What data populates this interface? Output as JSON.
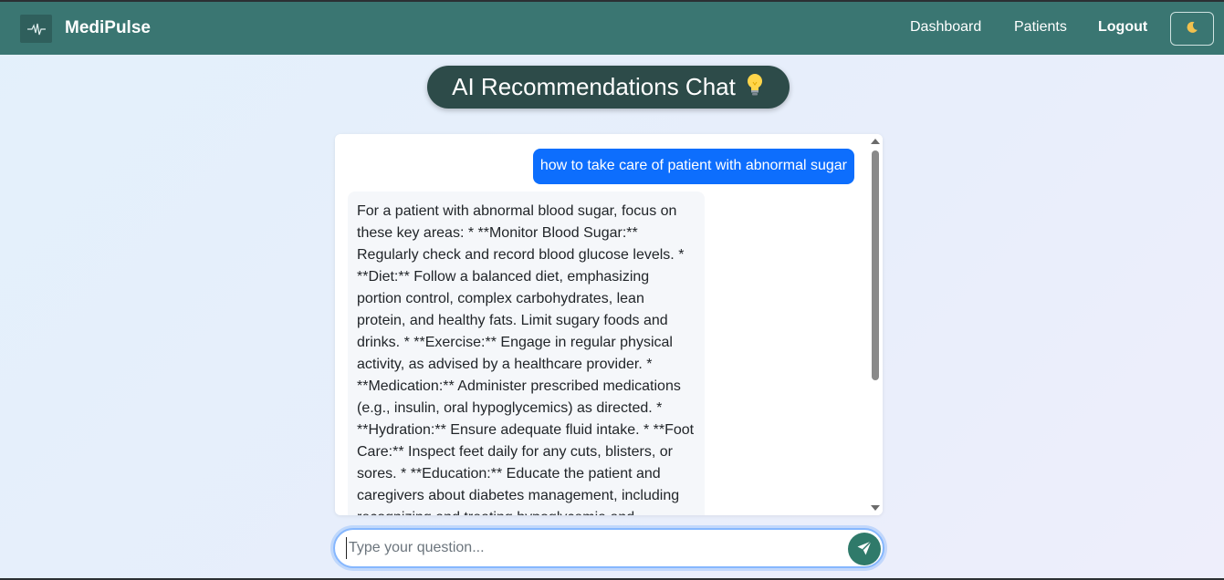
{
  "app": {
    "brand_name": "MediPulse",
    "brand_icon": "heartbeat-icon"
  },
  "nav": {
    "items": [
      {
        "label": "Dashboard"
      },
      {
        "label": "Patients"
      },
      {
        "label": "Logout"
      }
    ],
    "theme_toggle_icon": "moon-icon"
  },
  "page": {
    "title": "AI Recommendations Chat",
    "title_icon": "lightbulb-icon"
  },
  "chat": {
    "messages": [
      {
        "role": "user",
        "text": "how to take care of patient with abnormal sugar"
      },
      {
        "role": "assistant",
        "text": "For a patient with abnormal blood sugar, focus on these key areas: * **Monitor Blood Sugar:** Regularly check and record blood glucose levels. * **Diet:** Follow a balanced diet, emphasizing portion control, complex carbohydrates, lean protein, and healthy fats. Limit sugary foods and drinks. * **Exercise:** Engage in regular physical activity, as advised by a healthcare provider. * **Medication:** Administer prescribed medications (e.g., insulin, oral hypoglycemics) as directed. * **Hydration:** Ensure adequate fluid intake. * **Foot Care:** Inspect feet daily for any cuts, blisters, or sores. * **Education:** Educate the patient and caregivers about diabetes management, including recognizing and treating hypoglycemia and"
      }
    ]
  },
  "input": {
    "placeholder": "Type your question...",
    "value": "",
    "send_icon": "send-icon"
  },
  "colors": {
    "navbar": "#3a7672",
    "title_pill": "#2d4b49",
    "user_bubble": "#0d6efd",
    "send_button": "#2f7a6a"
  }
}
